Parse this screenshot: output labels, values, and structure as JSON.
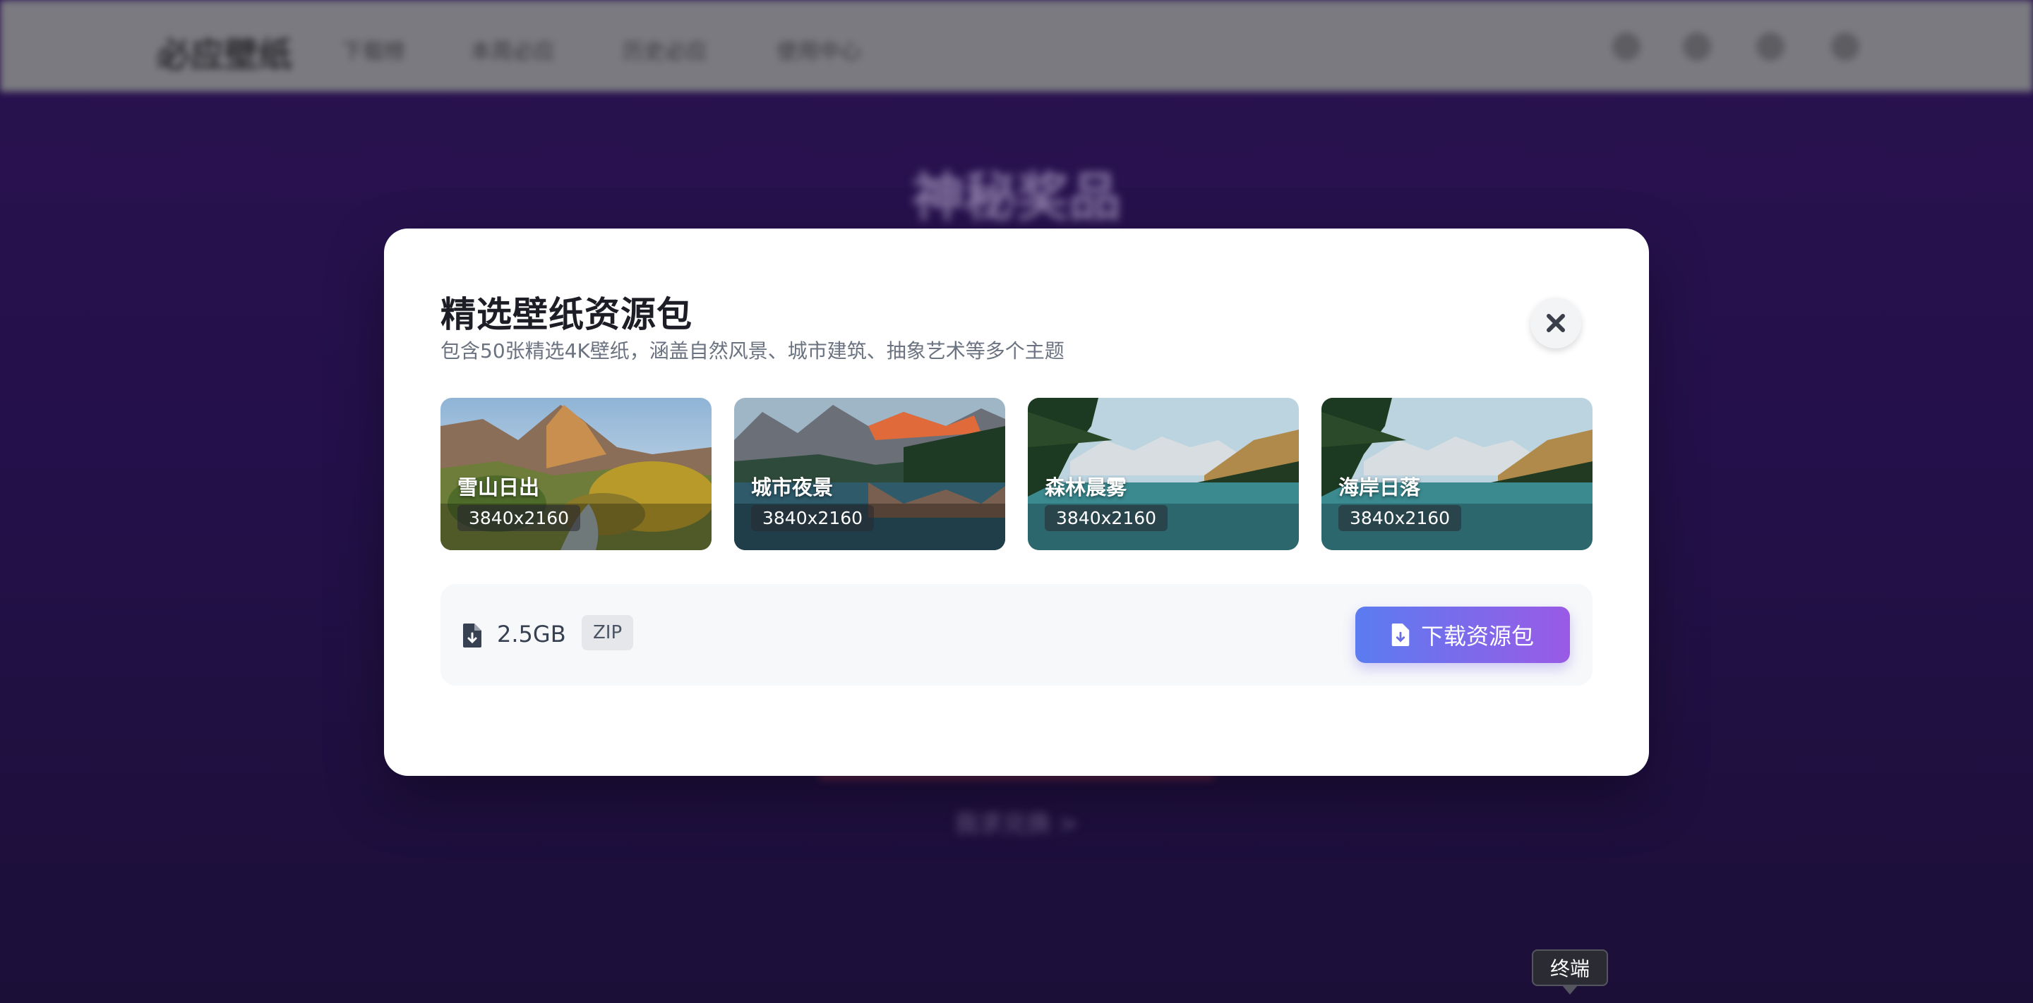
{
  "background_page": {
    "logo": "必应壁纸",
    "nav": [
      "下载榜",
      "本周必应",
      "历史必应",
      "使用中心"
    ],
    "title": "神秘奖品",
    "sub_link": "我求兑换 >"
  },
  "modal": {
    "title": "精选壁纸资源包",
    "description": "包含50张精选4K壁纸，涵盖自然风景、城市建筑、抽象艺术等多个主题",
    "close_icon": "close-icon",
    "thumbnails": [
      {
        "label": "雪山日出",
        "resolution": "3840x2160"
      },
      {
        "label": "城市夜景",
        "resolution": "3840x2160"
      },
      {
        "label": "森林晨雾",
        "resolution": "3840x2160"
      },
      {
        "label": "海岸日落",
        "resolution": "3840x2160"
      }
    ],
    "file_size": "2.5GB",
    "format": "ZIP",
    "download_label": "下载资源包",
    "accent_gradient": [
      "#5b7cf0",
      "#9a5ae6"
    ]
  },
  "tooltip": {
    "text": "终端"
  }
}
